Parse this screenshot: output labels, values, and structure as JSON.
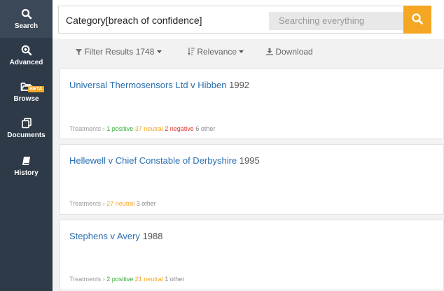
{
  "sidebar": {
    "items": [
      {
        "label": "Search",
        "icon": "search-icon"
      },
      {
        "label": "Advanced",
        "icon": "zoom-plus-icon"
      },
      {
        "label": "Browse",
        "icon": "folder-icon",
        "badge": "BETA"
      },
      {
        "label": "Documents",
        "icon": "documents-icon"
      },
      {
        "label": "History",
        "icon": "book-icon"
      }
    ]
  },
  "search": {
    "query": "Category[breach of confidence]",
    "scope": "Searching everything"
  },
  "filters": {
    "filter_label": "Filter Results 1748",
    "sort_label": "Relevance",
    "download_label": "Download"
  },
  "results": [
    {
      "title": "Universal Thermosensors Ltd v Hibben",
      "year": "1992",
      "treatments_label": "Treatments",
      "positive": "1 positive",
      "neutral": "37 neutral",
      "negative": "2 negative",
      "other": "6 other"
    },
    {
      "title": "Hellewell v Chief Constable of Derbyshire",
      "year": "1995",
      "treatments_label": "Treatments",
      "positive": "",
      "neutral": "27 neutral",
      "negative": "",
      "other": "3 other"
    },
    {
      "title": "Stephens v Avery",
      "year": "1988",
      "treatments_label": "Treatments",
      "positive": "2 positive",
      "neutral": "21 neutral",
      "negative": "",
      "other": "1 other"
    }
  ],
  "colors": {
    "accent": "#f5a623",
    "sidebar": "#2e3a48",
    "link": "#2b6fb0",
    "positive": "#3aaa3a",
    "neutral": "#f5a623",
    "negative": "#e0352b"
  }
}
